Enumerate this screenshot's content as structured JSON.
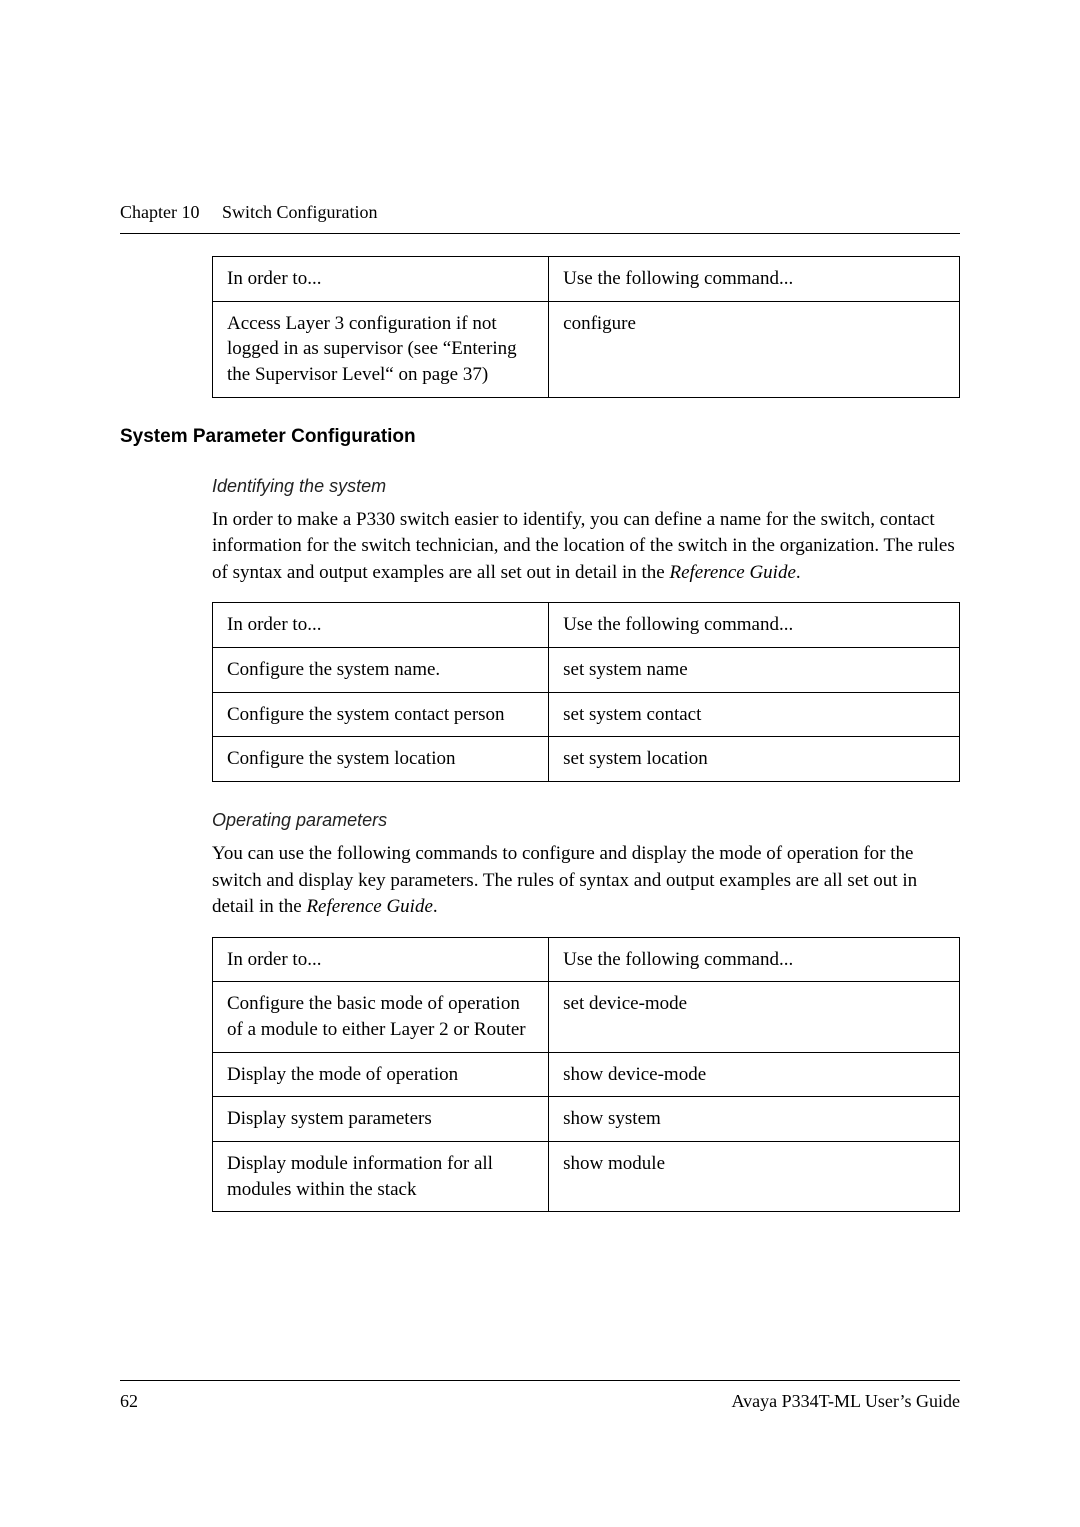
{
  "header": {
    "chapter": "Chapter 10",
    "title": "Switch Configuration"
  },
  "table1": {
    "header": {
      "col1": "In order to...",
      "col2": "Use the following command..."
    },
    "rows": [
      {
        "col1": "Access Layer 3 configuration if not logged in as supervisor (see “Entering the Supervisor Level“ on page 37)",
        "col2": "configure"
      }
    ]
  },
  "section1": {
    "heading": "System Parameter Configuration",
    "sub1": {
      "heading": "Identifying the system",
      "paragraph": "In order to make a P330 switch easier to identify, you can define a name for the switch, contact information for the switch technician, and the location of the switch in the organization. The rules of syntax and output examples are all set out in detail in the ",
      "paragraph_italic": "Reference Guide",
      "paragraph_end": "."
    }
  },
  "table2": {
    "header": {
      "col1": "In order to...",
      "col2": "Use the following command..."
    },
    "rows": [
      {
        "col1": "Configure the system name.",
        "col2": "set system name"
      },
      {
        "col1": "Configure the system contact person",
        "col2": "set system contact"
      },
      {
        "col1": "Configure the system location",
        "col2": "set system location"
      }
    ]
  },
  "section2": {
    "sub1": {
      "heading": "Operating parameters",
      "paragraph": "You can use the following commands to configure and display the mode of operation for the switch and display key parameters. The rules of syntax and output examples are all set out in detail in the ",
      "paragraph_italic": "Reference Guide",
      "paragraph_end": "."
    }
  },
  "table3": {
    "header": {
      "col1": "In order to...",
      "col2": "Use the following command..."
    },
    "rows": [
      {
        "col1": "Configure the basic mode of operation of a module to either Layer 2 or Router",
        "col2": "set device-mode"
      },
      {
        "col1": "Display the mode of operation",
        "col2": "show device-mode"
      },
      {
        "col1": "Display system parameters",
        "col2": "show system"
      },
      {
        "col1": "Display module information for all modules within the stack",
        "col2": "show module"
      }
    ]
  },
  "footer": {
    "page": "62",
    "docTitle": "Avaya P334T-ML User’s Guide"
  }
}
